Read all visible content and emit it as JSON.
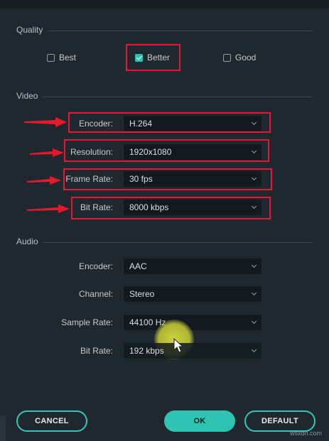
{
  "quality": {
    "section_label": "Quality",
    "options": [
      {
        "label": "Best",
        "checked": false
      },
      {
        "label": "Better",
        "checked": true
      },
      {
        "label": "Good",
        "checked": false
      }
    ]
  },
  "video": {
    "section_label": "Video",
    "rows": [
      {
        "label": "Encoder:",
        "value": "H.264"
      },
      {
        "label": "Resolution:",
        "value": "1920x1080"
      },
      {
        "label": "Frame Rate:",
        "value": "30 fps"
      },
      {
        "label": "Bit Rate:",
        "value": "8000 kbps"
      }
    ]
  },
  "audio": {
    "section_label": "Audio",
    "rows": [
      {
        "label": "Encoder:",
        "value": "AAC"
      },
      {
        "label": "Channel:",
        "value": "Stereo"
      },
      {
        "label": "Sample Rate:",
        "value": "44100 Hz"
      },
      {
        "label": "Bit Rate:",
        "value": "192 kbps"
      }
    ]
  },
  "buttons": {
    "cancel": "CANCEL",
    "ok": "OK",
    "default": "DEFAULT"
  },
  "watermark": "wsxdn.com",
  "colors": {
    "background": "#1f282f",
    "accent": "#2ec3b3",
    "annotation_red": "#e5192d",
    "dropdown_bg": "#121a1f"
  }
}
